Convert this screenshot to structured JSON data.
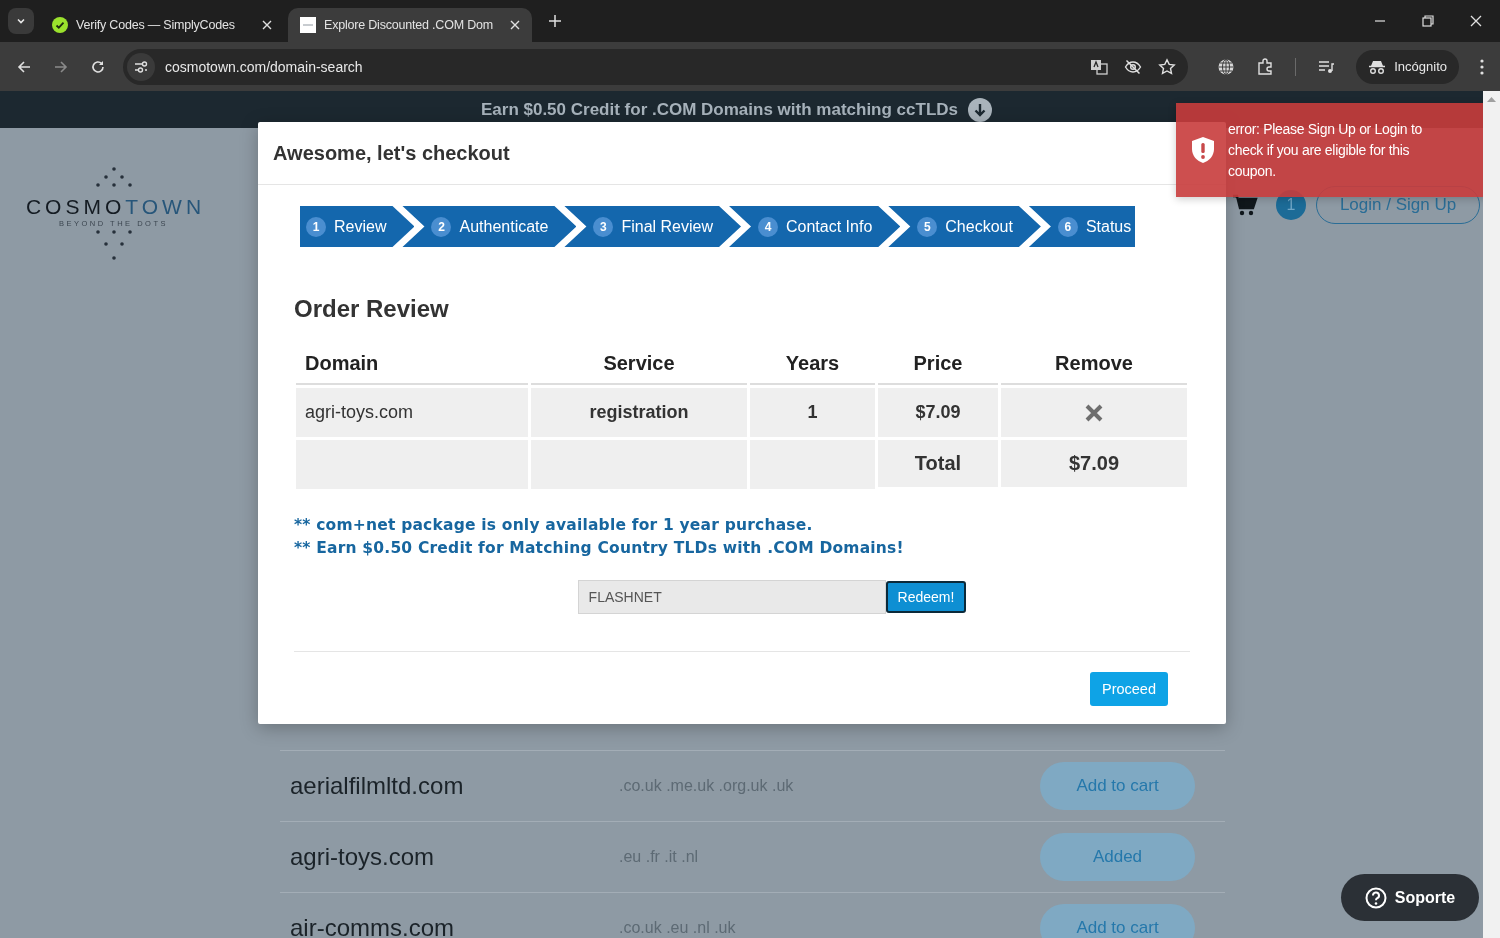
{
  "browser": {
    "tabs": [
      {
        "title": "Verify Codes — SimplyCodes",
        "selected": false
      },
      {
        "title": "Explore Discounted .COM Dom",
        "selected": true
      }
    ],
    "url": "cosmotown.com/domain-search",
    "profile": "Incógnito"
  },
  "banner": "Earn $0.50 Credit for .COM Domains with matching ccTLDs",
  "logo": {
    "wordmark": [
      "COSMO",
      "TOWN"
    ],
    "tagline": "BEYOND THE DOTS"
  },
  "header": {
    "cart_count": "1",
    "login": "Login / Sign Up"
  },
  "domains": [
    {
      "name": "aerialfilmltd.com",
      "tlds": ".co.uk .me.uk .org.uk .uk",
      "action": "Add to cart"
    },
    {
      "name": "agri-toys.com",
      "tlds": ".eu .fr .it .nl",
      "action": "Added"
    },
    {
      "name": "air-comms.com",
      "tlds": ".co.uk .eu .nl .uk",
      "action": "Add to cart"
    }
  ],
  "modal": {
    "title": "Awesome, let's checkout",
    "steps": [
      {
        "number": "1",
        "label": "Review"
      },
      {
        "number": "2",
        "label": "Authenticate"
      },
      {
        "number": "3",
        "label": "Final Review"
      },
      {
        "number": "4",
        "label": "Contact Info"
      },
      {
        "number": "5",
        "label": "Checkout"
      },
      {
        "number": "6",
        "label": "Status"
      }
    ],
    "heading": "Order Review",
    "columns": [
      "Domain",
      "Service",
      "Years",
      "Price",
      "Remove"
    ],
    "rows": [
      {
        "domain": "agri-toys.com",
        "service": "registration",
        "years": "1",
        "price": "$7.09"
      }
    ],
    "total": {
      "label": "Total",
      "amount": "$7.09"
    },
    "notes": [
      "** com+net package is only available for 1 year purchase.",
      "** Earn $0.50 Credit for Matching Country TLDs with .COM Domains!"
    ],
    "coupon": {
      "value": "FLASHNET",
      "button": "Redeem!"
    },
    "proceed": "Proceed"
  },
  "toast": {
    "message": "error: Please Sign Up or Login to check if you are eligible for this coupon."
  },
  "support": "Soporte"
}
